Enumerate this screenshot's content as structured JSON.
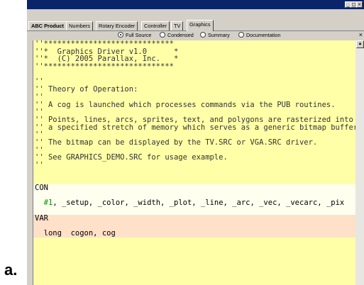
{
  "figure_label": "a.",
  "window": {
    "buttons": [
      "_",
      "□",
      "×"
    ]
  },
  "tabs": [
    {
      "label": "ABC Product",
      "bold": true,
      "active": false
    },
    {
      "label": "Numbers",
      "bold": false,
      "active": false
    },
    {
      "label": "Rotary Encoder",
      "bold": false,
      "active": false
    },
    {
      "label": "Controller",
      "bold": false,
      "active": false
    },
    {
      "label": "TV",
      "bold": false,
      "active": false
    },
    {
      "label": "Graphics",
      "bold": false,
      "active": true
    }
  ],
  "view_options": [
    {
      "label": "Full Source",
      "selected": true
    },
    {
      "label": "Condensed",
      "selected": false
    },
    {
      "label": "Summary",
      "selected": false
    },
    {
      "label": "Documentation",
      "selected": false
    }
  ],
  "close_icon": "×",
  "scroll_up_icon": "▲",
  "code_lines": [
    {
      "text": "''*****************************",
      "style": "doc"
    },
    {
      "text": "''*  Graphics Driver v1.0      *",
      "style": "doc"
    },
    {
      "text": "''*  (C) 2005 Parallax, Inc.   *",
      "style": "doc"
    },
    {
      "text": "''*****************************",
      "style": "doc"
    },
    {
      "text": "",
      "style": "doc"
    },
    {
      "text": "''",
      "style": "doc"
    },
    {
      "text": "'' Theory of Operation:",
      "style": "doc"
    },
    {
      "text": "''",
      "style": "doc"
    },
    {
      "text": "'' A cog is launched which processes commands via the PUB routines.",
      "style": "doc"
    },
    {
      "text": "''",
      "style": "doc"
    },
    {
      "text": "'' Points, lines, arcs, sprites, text, and polygons are rasterized into",
      "style": "doc"
    },
    {
      "text": "'' a specified stretch of memory which serves as a generic bitmap buffer.",
      "style": "doc"
    },
    {
      "text": "''",
      "style": "doc"
    },
    {
      "text": "'' The bitmap can be displayed by the TV.SRC or VGA.SRC driver.",
      "style": "doc"
    },
    {
      "text": "''",
      "style": "doc"
    },
    {
      "text": "'' See GRAPHICS_DEMO.SRC for usage example.",
      "style": "doc"
    },
    {
      "text": "''",
      "style": "doc"
    },
    {
      "text": "",
      "style": "doc"
    },
    {
      "text": "",
      "style": "doc"
    },
    {
      "text": "CON",
      "style": "con"
    },
    {
      "text": "",
      "style": "con"
    },
    {
      "text": "  #1, _setup, _color, _width, _plot, _line, _arc, _vec, _vecarc, _pix",
      "style": "con"
    },
    {
      "text": "",
      "style": "con"
    },
    {
      "text": "VAR",
      "style": "var"
    },
    {
      "text": "",
      "style": "var"
    },
    {
      "text": "  long  cogon, cog",
      "style": "var"
    }
  ]
}
